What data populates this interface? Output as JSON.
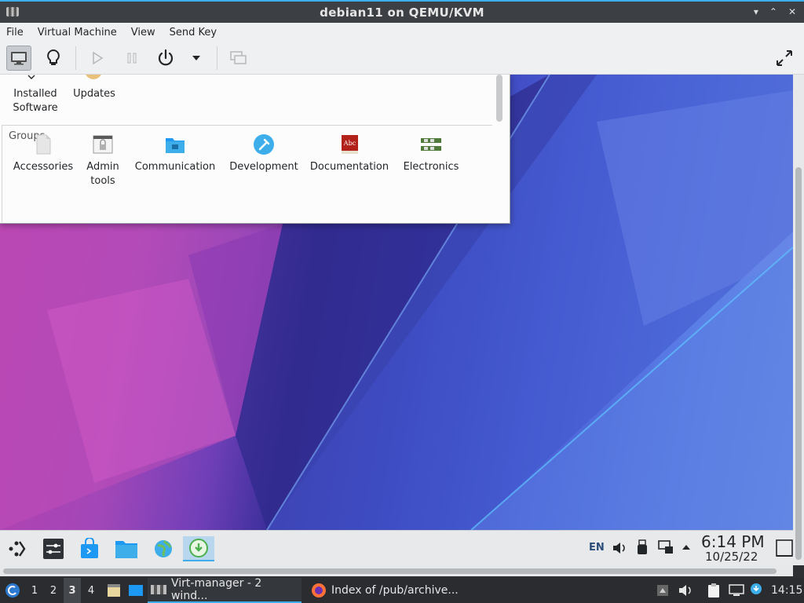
{
  "window": {
    "title": "debian11 on QEMU/KVM",
    "controls": [
      "▾",
      "⌃",
      "✕"
    ]
  },
  "menu": {
    "items": [
      "File",
      "Virtual Machine",
      "View",
      "Send Key"
    ]
  },
  "toolbar": {
    "buttons": [
      "monitor-icon",
      "lightbulb-icon",
      "play-icon",
      "pause-icon",
      "power-icon",
      "dropdown-icon",
      "screens-icon",
      "fullscreen-icon"
    ]
  },
  "software_center": {
    "top_items": [
      {
        "label_line1": "Installed",
        "label_line2": "Software"
      },
      {
        "label_line1": "Updates",
        "label_line2": ""
      }
    ],
    "groups_label": "Groups",
    "groups": [
      {
        "line1": "Accessories",
        "line2": ""
      },
      {
        "line1": "Admin",
        "line2": "tools"
      },
      {
        "line1": "Communication",
        "line2": ""
      },
      {
        "line1": "Development",
        "line2": ""
      },
      {
        "line1": "Documentation",
        "line2": ""
      },
      {
        "line1": "Electronics",
        "line2": ""
      }
    ]
  },
  "guest_panel": {
    "tray_lang": "EN",
    "time": "6:14 PM",
    "date": "10/25/22"
  },
  "host_taskbar": {
    "desktops": [
      "1",
      "2",
      "3",
      "4"
    ],
    "current_desktop": "3",
    "tasks": [
      {
        "label": "Virt-manager - 2 wind..."
      },
      {
        "label": "Index of /pub/archive..."
      }
    ],
    "clock": "14:15"
  },
  "colors": {
    "accent": "#3daee9",
    "titlebar": "#3c3f44",
    "taskbar": "#2a2c30"
  }
}
